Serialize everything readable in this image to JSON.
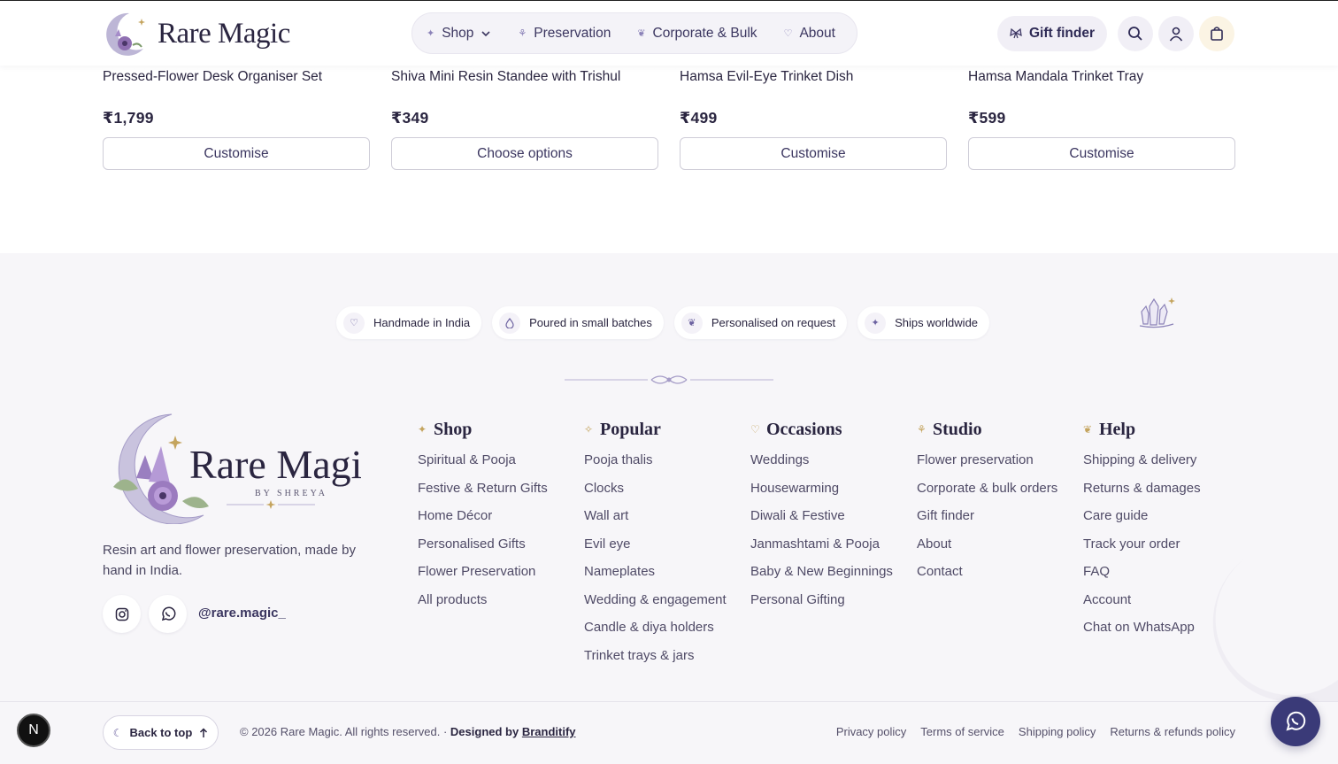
{
  "header": {
    "logo_text": "Rare Magic",
    "nav": [
      {
        "label": "Shop",
        "icon": "sparkle-icon"
      },
      {
        "label": "Preservation",
        "icon": "flower-icon"
      },
      {
        "label": "Corporate & Bulk",
        "icon": "leaf-icon"
      },
      {
        "label": "About",
        "icon": "heart-icon"
      }
    ],
    "gift_finder": "Gift finder"
  },
  "products": [
    {
      "name": "Pressed-Flower Desk Organiser Set",
      "price": "₹1,799",
      "action": "Customise"
    },
    {
      "name": "Shiva Mini Resin Standee with Trishul",
      "price": "₹349",
      "action": "Choose options"
    },
    {
      "name": "Hamsa Evil-Eye Trinket Dish",
      "price": "₹499",
      "action": "Customise"
    },
    {
      "name": "Hamsa Mandala Trinket Tray",
      "price": "₹599",
      "action": "Customise"
    }
  ],
  "badges": [
    {
      "label": "Handmade in India",
      "icon": "heart-icon"
    },
    {
      "label": "Poured in small batches",
      "icon": "drop-icon"
    },
    {
      "label": "Personalised on request",
      "icon": "leaf-icon"
    },
    {
      "label": "Ships worldwide",
      "icon": "sparkle-icon"
    }
  ],
  "brand": {
    "logo_main": "Rare Magic",
    "logo_sub": "BY SHREYA",
    "description": "Resin art and flower preservation, made by hand in India.",
    "handle": "@rare.magic_"
  },
  "columns": [
    {
      "title": "Shop",
      "icon": "sparkle-icon",
      "links": [
        "Spiritual & Pooja",
        "Festive & Return Gifts",
        "Home Décor",
        "Personalised Gifts",
        "Flower Preservation",
        "All products"
      ]
    },
    {
      "title": "Popular",
      "icon": "star-icon",
      "links": [
        "Pooja thalis",
        "Clocks",
        "Wall art",
        "Evil eye",
        "Nameplates",
        "Wedding & engagement",
        "Candle & diya holders",
        "Trinket trays & jars"
      ]
    },
    {
      "title": "Occasions",
      "icon": "heart-icon",
      "links": [
        "Weddings",
        "Housewarming",
        "Diwali & Festive",
        "Janmashtami & Pooja",
        "Baby & New Beginnings",
        "Personal Gifting"
      ]
    },
    {
      "title": "Studio",
      "icon": "flower-icon",
      "links": [
        "Flower preservation",
        "Corporate & bulk orders",
        "Gift finder",
        "About",
        "Contact"
      ]
    },
    {
      "title": "Help",
      "icon": "leaf-icon",
      "links": [
        "Shipping & delivery",
        "Returns & damages",
        "Care guide",
        "Track your order",
        "FAQ",
        "Account",
        "Chat on WhatsApp"
      ]
    }
  ],
  "bottom": {
    "back_to_top": "Back to top",
    "copyright": "© 2026 Rare Magic. All rights reserved. ·",
    "designed_by": "Designed by",
    "designer": "Branditify",
    "policies": [
      "Privacy policy",
      "Terms of service",
      "Shipping policy",
      "Returns & refunds policy"
    ]
  },
  "dev_badge": "N",
  "colors": {
    "accent": "#3a3a78",
    "footer_bg": "#f7f6f9",
    "gold": "#c4a45e",
    "lavender": "#8b82b8"
  }
}
